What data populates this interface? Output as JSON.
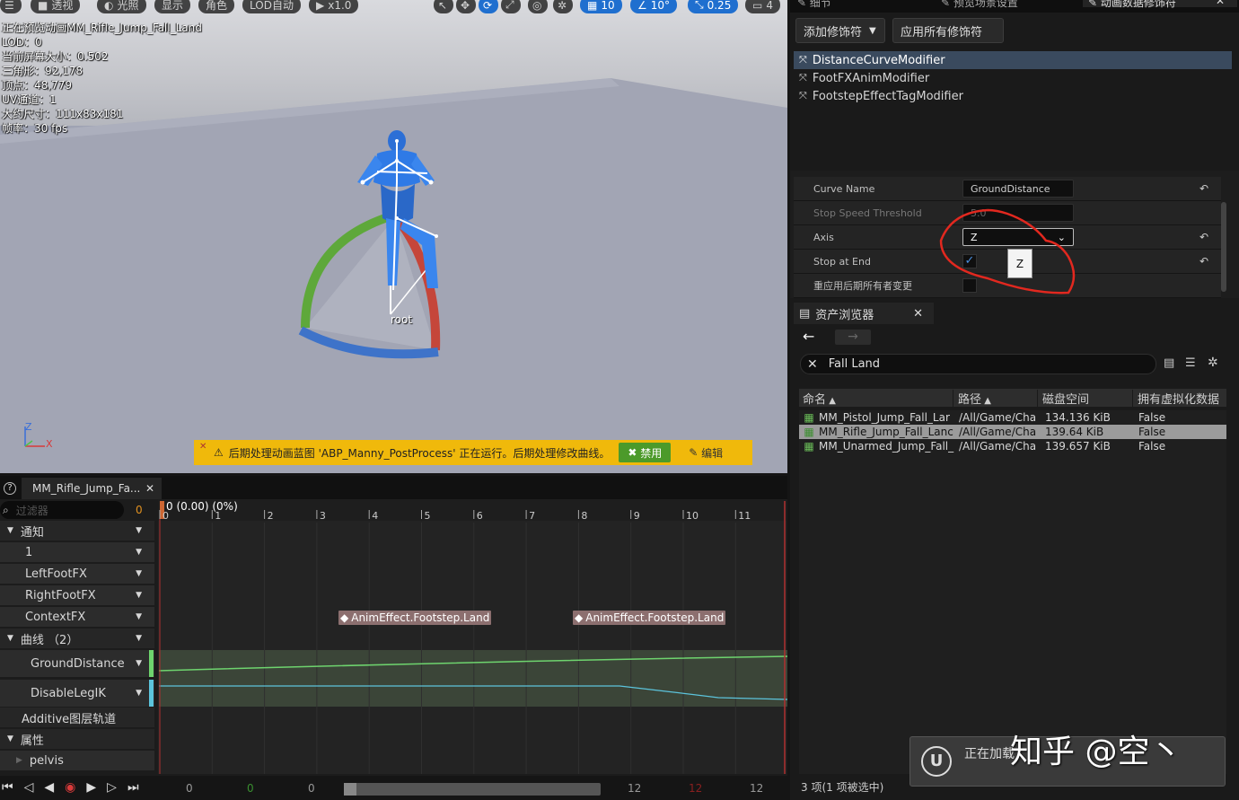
{
  "viewport": {
    "toolbar": {
      "perspective": "透视",
      "lit": "光照",
      "show": "显示",
      "character": "角色",
      "lod": "LOD自动",
      "speed": "x1.0",
      "grid_snap": "10",
      "rot_snap": "10°",
      "scale_snap": "0.25",
      "cam_speed": "4"
    },
    "stats": [
      "正在预览动画MM_Rifle_Jump_Fall_Land",
      "LOD：0",
      "当前屏幕大小：0.502",
      "三角形：92,178",
      "顶点：48,779",
      "UV通道：1",
      "大约尺寸：111x83x181",
      "帧率：30 fps"
    ],
    "bone_label": "root",
    "axes": {
      "z": "Z",
      "x": "X"
    },
    "warning": {
      "text": "后期处理动画蓝图 'ABP_Manny_PostProcess' 正在运行。后期处理修改曲线。",
      "disable": "禁用",
      "edit": "编辑"
    }
  },
  "right_panel": {
    "tabs": [
      "细节",
      "预览场景设置",
      "动画数据修饰符"
    ],
    "add_modifier": "添加修饰符",
    "apply_all": "应用所有修饰符",
    "modifiers": [
      "DistanceCurveModifier",
      "FootFXAnimModifier",
      "FootstepEffectTagModifier"
    ],
    "props": [
      {
        "label": "Curve Name",
        "value": "GroundDistance"
      },
      {
        "label": "Stop Speed Threshold",
        "value": "5.0"
      },
      {
        "label": "Axis",
        "value": "Z"
      },
      {
        "label": "Stop at End",
        "value": ""
      },
      {
        "label": "重应用后期所有者变更",
        "value": ""
      }
    ],
    "axis_tooltip": "Z"
  },
  "content_browser": {
    "tab": "资产浏览器",
    "search": "Fall Land",
    "columns": [
      "命名",
      "路径",
      "磁盘空间",
      "拥有虚拟化数据"
    ],
    "rows": [
      {
        "name": "MM_Pistol_Jump_Fall_Lar",
        "path": "/All/Game/Cha",
        "size": "134.136 KiB",
        "virt": "False"
      },
      {
        "name": "MM_Rifle_Jump_Fall_Lanc",
        "path": "/All/Game/Cha",
        "size": "139.64 KiB",
        "virt": "False"
      },
      {
        "name": "MM_Unarmed_Jump_Fall_",
        "path": "/All/Game/Cha",
        "size": "139.657 KiB",
        "virt": "False"
      }
    ],
    "status": "3 项(1 项被选中)",
    "toast": "正在加载",
    "watermark": "知乎 @空丶"
  },
  "timeline": {
    "tab": "MM_Rifle_Jump_Fa...",
    "filter_placeholder": "过滤器",
    "filter_count": "0",
    "frame_label": "0 (0.00) (0%)",
    "ticks": [
      "0",
      "1",
      "2",
      "3",
      "4",
      "5",
      "6",
      "7",
      "8",
      "9",
      "10",
      "11"
    ],
    "tracks": {
      "notify": "通知",
      "n1": "1",
      "left": "LeftFootFX",
      "right": "RightFootFX",
      "context": "ContextFX",
      "curves": "曲线 （2）",
      "ground": "GroundDistance",
      "legik": "DisableLegIK",
      "additive": "Additive图层轨道",
      "attrs": "属性",
      "pelvis": "pelvis"
    },
    "notifies": [
      "AnimEffect.Footstep.Land",
      "AnimEffect.Footstep.Land"
    ],
    "footer": [
      "0",
      "0",
      "0",
      "12",
      "12",
      "12"
    ]
  }
}
